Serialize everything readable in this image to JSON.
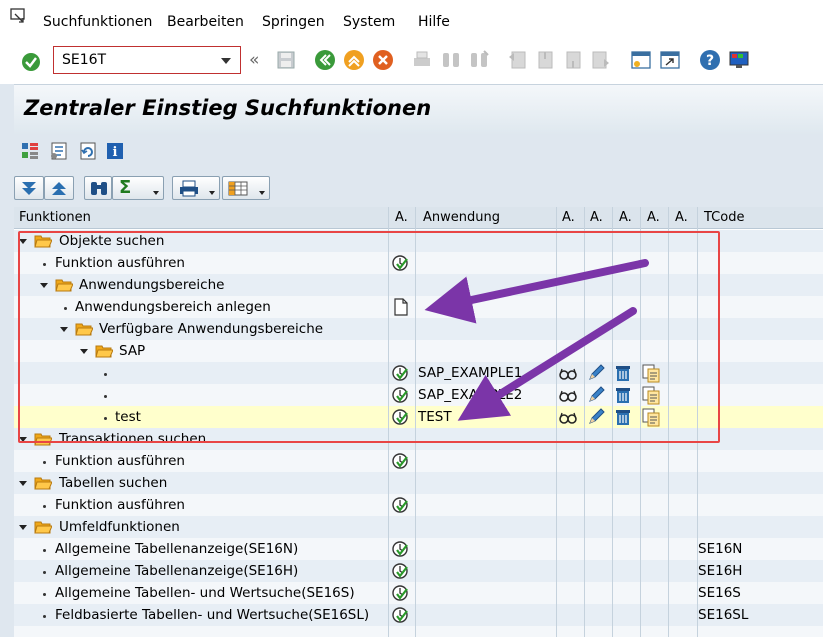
{
  "menu": {
    "items": [
      "Suchfunktionen",
      "Bearbeiten",
      "Springen",
      "System",
      "Hilfe"
    ]
  },
  "toolbar": {
    "command_value": "SE16T",
    "nav_back_glyph": "«"
  },
  "page": {
    "title": "Zentraler Einstieg Suchfunktionen"
  },
  "tree": {
    "columns": [
      "Funktionen",
      "A.",
      "Anwendung",
      "A.",
      "A.",
      "A.",
      "A.",
      "A.",
      "TCode"
    ],
    "rows": [
      {
        "label": "Objekte suchen",
        "app": "",
        "tcode": ""
      },
      {
        "label": "Funktion ausführen",
        "app": "",
        "tcode": ""
      },
      {
        "label": "Anwendungsbereiche",
        "app": "",
        "tcode": ""
      },
      {
        "label": "Anwendungsbereich anlegen",
        "app": "",
        "tcode": ""
      },
      {
        "label": "Verfügbare Anwendungsbereiche",
        "app": "",
        "tcode": ""
      },
      {
        "label": "SAP",
        "app": "",
        "tcode": ""
      },
      {
        "label": "",
        "app": "SAP_EXAMPLE1",
        "tcode": ""
      },
      {
        "label": "",
        "app": "SAP_EXAMPLE2",
        "tcode": ""
      },
      {
        "label": "test",
        "app": "TEST",
        "tcode": ""
      },
      {
        "label": "Transaktionen suchen",
        "app": "",
        "tcode": ""
      },
      {
        "label": "Funktion ausführen",
        "app": "",
        "tcode": ""
      },
      {
        "label": "Tabellen suchen",
        "app": "",
        "tcode": ""
      },
      {
        "label": "Funktion ausführen",
        "app": "",
        "tcode": ""
      },
      {
        "label": "Umfeldfunktionen",
        "app": "",
        "tcode": ""
      },
      {
        "label": "Allgemeine Tabellenanzeige(SE16N)",
        "app": "",
        "tcode": "SE16N"
      },
      {
        "label": "Allgemeine Tabellenanzeige(SE16H)",
        "app": "",
        "tcode": "SE16H"
      },
      {
        "label": "Allgemeine Tabellen- und Wertsuche(SE16S)",
        "app": "",
        "tcode": "SE16S"
      },
      {
        "label": "Feldbasierte Tabellen- und Wertsuche(SE16SL)",
        "app": "",
        "tcode": "SE16SL"
      }
    ]
  },
  "colors": {
    "accent_box": "#e84545",
    "arrow": "#7b35a8",
    "selected_row": "#ffffcc"
  }
}
